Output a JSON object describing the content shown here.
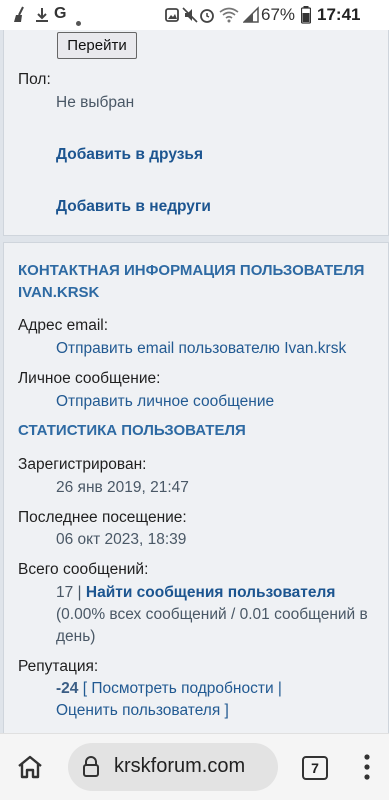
{
  "status_bar": {
    "notification_icons": [
      "broom-icon",
      "download-icon",
      "google-icon",
      "dot-icon"
    ],
    "right_icons": [
      "image-icon",
      "mute-icon",
      "alarm-icon",
      "wifi-icon",
      "signal-icon"
    ],
    "battery": "67%",
    "time": "17:41"
  },
  "card1": {
    "go_button": "Перейти",
    "gender_label": "Пол:",
    "gender_value": "Не выбран",
    "add_friend": "Добавить в друзья",
    "add_foe": "Добавить в недруги"
  },
  "contact": {
    "header_line1": "КОНТАКТНАЯ ИНФОРМАЦИЯ ПОЛЬЗОВАТЕЛЯ",
    "header_line2": "IVAN.KRSK",
    "email_label": "Адрес email:",
    "email_link": "Отправить email пользователю Ivan.krsk",
    "pm_label": "Личное сообщение:",
    "pm_link": "Отправить личное сообщение"
  },
  "stats": {
    "header": "СТАТИСТИКА ПОЛЬЗОВАТЕЛЯ",
    "registered_label": "Зарегистрирован:",
    "registered_value": "26 янв 2019, 21:47",
    "last_visit_label": "Последнее посещение:",
    "last_visit_value": "06 окт 2023, 18:39",
    "total_posts_label": "Всего сообщений:",
    "total_posts_count": "17",
    "sep": " | ",
    "find_posts_link": "Найти сообщения пользователя",
    "posts_percent_line1": "(0.00% всех сообщений / 0.01 сообщений в",
    "posts_percent_line2": "день)",
    "reputation_label": "Репутация:",
    "reputation_value": "-24",
    "rep_open": " [ ",
    "view_details": "Посмотреть подробности",
    "rep_pipe": " |",
    "rate_user": "Оценить пользователя",
    "rep_close": " ]"
  },
  "navbar": {
    "url": "krskforum.com",
    "tab_count": "7"
  }
}
